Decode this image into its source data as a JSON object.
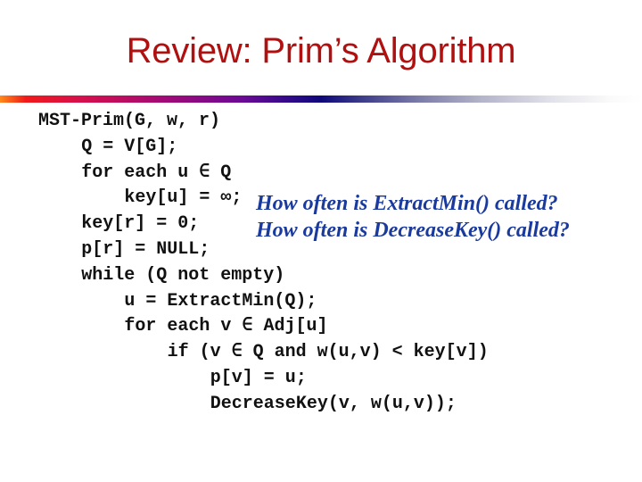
{
  "slide": {
    "title": "Review: Prim’s Algorithm",
    "accent_colors": {
      "title": "#b01010",
      "question_text": "#1a3a9e",
      "code_text": "#111111",
      "rule_gradient": [
        "#ff8a1a",
        "#f01a1a",
        "#a00a78",
        "#10087a",
        "#b4b4ca",
        "#ffffff"
      ]
    },
    "code": {
      "lines": [
        {
          "indent": 0,
          "text": "MST-Prim(G, w, r)"
        },
        {
          "indent": 1,
          "text": "Q = V[G];"
        },
        {
          "indent": 1,
          "text": "for each u ∈ Q"
        },
        {
          "indent": 2,
          "text": "key[u] = ∞;"
        },
        {
          "indent": 1,
          "text": "key[r] = 0;"
        },
        {
          "indent": 1,
          "text": "p[r] = NULL;"
        },
        {
          "indent": 1,
          "text": "while (Q not empty)"
        },
        {
          "indent": 2,
          "text": "u = ExtractMin(Q);"
        },
        {
          "indent": 2,
          "text": "for each v ∈ Adj[u]"
        },
        {
          "indent": 3,
          "text": "if (v ∈ Q and w(u,v) < key[v])"
        },
        {
          "indent": 4,
          "text": "p[v] = u;"
        },
        {
          "indent": 4,
          "text": "DecreaseKey(v, w(u,v));"
        }
      ]
    },
    "questions": [
      "How often is ExtractMin() called?",
      "How often is DecreaseKey() called?"
    ]
  }
}
